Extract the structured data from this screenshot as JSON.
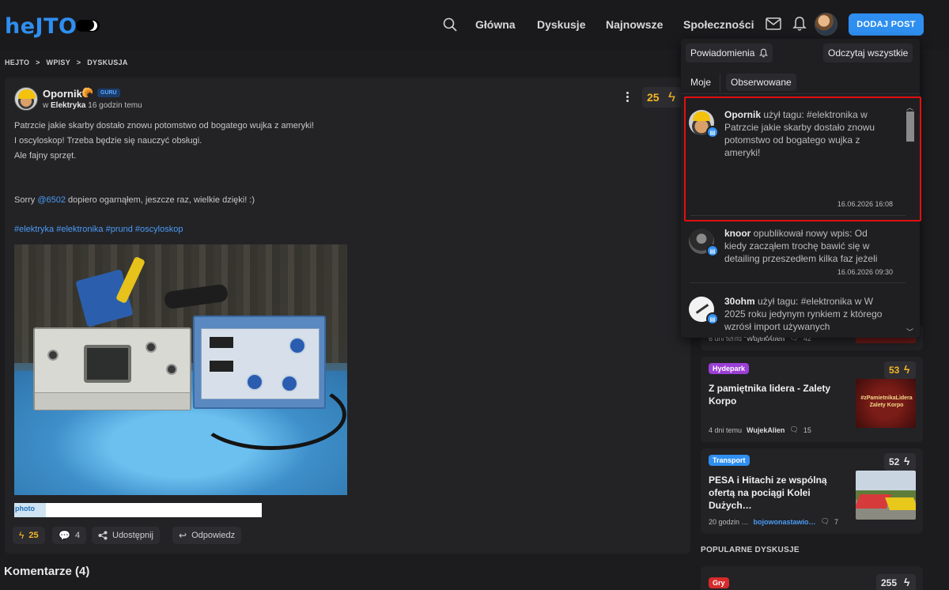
{
  "nav": {
    "logo": "heJTO",
    "links": [
      "Główna",
      "Dyskusje",
      "Najnowsze",
      "Społeczności"
    ],
    "add_post": "DODAJ POST"
  },
  "breadcrumb": [
    "HEJTO",
    ">",
    "WPISY",
    ">",
    "DYSKUSJA"
  ],
  "post": {
    "author": "Opornik",
    "badge": "GURU",
    "community": "Elektryka",
    "time": "16 godzin temu",
    "votes": "25",
    "lines": [
      "Patrzcie jakie skarby dostało znowu potomstwo od bogatego wujka z ameryki!",
      "I oscyloskop! Trzeba będzie się nauczyć obsługi.",
      "Ale fajny sprzęt."
    ],
    "sorry_prefix": "Sorry ",
    "mention": "@6502",
    "sorry_suffix": " dopiero ogarnąłem, jeszcze raz, wielkie dzięki! :)",
    "tags": [
      "#elektryka",
      "#elektronika",
      "#prund",
      "#oscyloskop"
    ],
    "ad_text": "photo",
    "actions": {
      "votes": "25",
      "comments": "4",
      "share": "Udostępnij",
      "reply": "Odpowiedz"
    }
  },
  "comments_title": "Komentarze (4)",
  "notifications": {
    "title": "Powiadomienia",
    "read_all": "Odczytaj wszystkie",
    "tabs": [
      "Moje",
      "Obserwowane"
    ],
    "items": [
      {
        "user": "Opornik",
        "text": " użył tagu: #elektronika w Patrzcie jakie skarby dostało znowu potomstwo od bogatego wujka z ameryki!",
        "time": "16.06.2026 16:08"
      },
      {
        "user": "knoor",
        "text": " opublikował nowy wpis: Od kiedy zacząłem trochę bawić się w detailing przeszedłem kilka faz jeżeli",
        "time": "16.06.2026 09:30"
      },
      {
        "user": "30ohm",
        "text": " użył tagu: #elektronika w W 2025 roku jedynym rynkiem z którego wzrósł import używanych samochodów",
        "time": ""
      }
    ]
  },
  "sidebar": {
    "partial_card": {
      "time": "6 dni temu",
      "user": "WujekAlien",
      "comments": "42"
    },
    "cards": [
      {
        "category": "Hydepark",
        "category_color": "#9b3fd6",
        "score": "53",
        "score_color": "#f5b623",
        "title": "Z pamiętnika lidera - Zalety Korpo",
        "thumb_text": "#zPamietnikaLidera Zalety Korpo",
        "time": "4 dni temu",
        "user": "WujekAlien",
        "comments": "15"
      },
      {
        "category": "Transport",
        "category_color": "#2f8ff0",
        "score": "52",
        "score_color": "#e6e6e6",
        "title": "PESA i Hitachi ze wspólną ofertą na pociągi Kolei Dużych…",
        "time": "20 godzin …",
        "user": "bojowonastawio…",
        "comments": "7"
      }
    ],
    "popular_title": "POPULARNE DYSKUSJE",
    "popular_card": {
      "category": "Gry",
      "category_color": "#d62b2b",
      "score": "255"
    }
  }
}
